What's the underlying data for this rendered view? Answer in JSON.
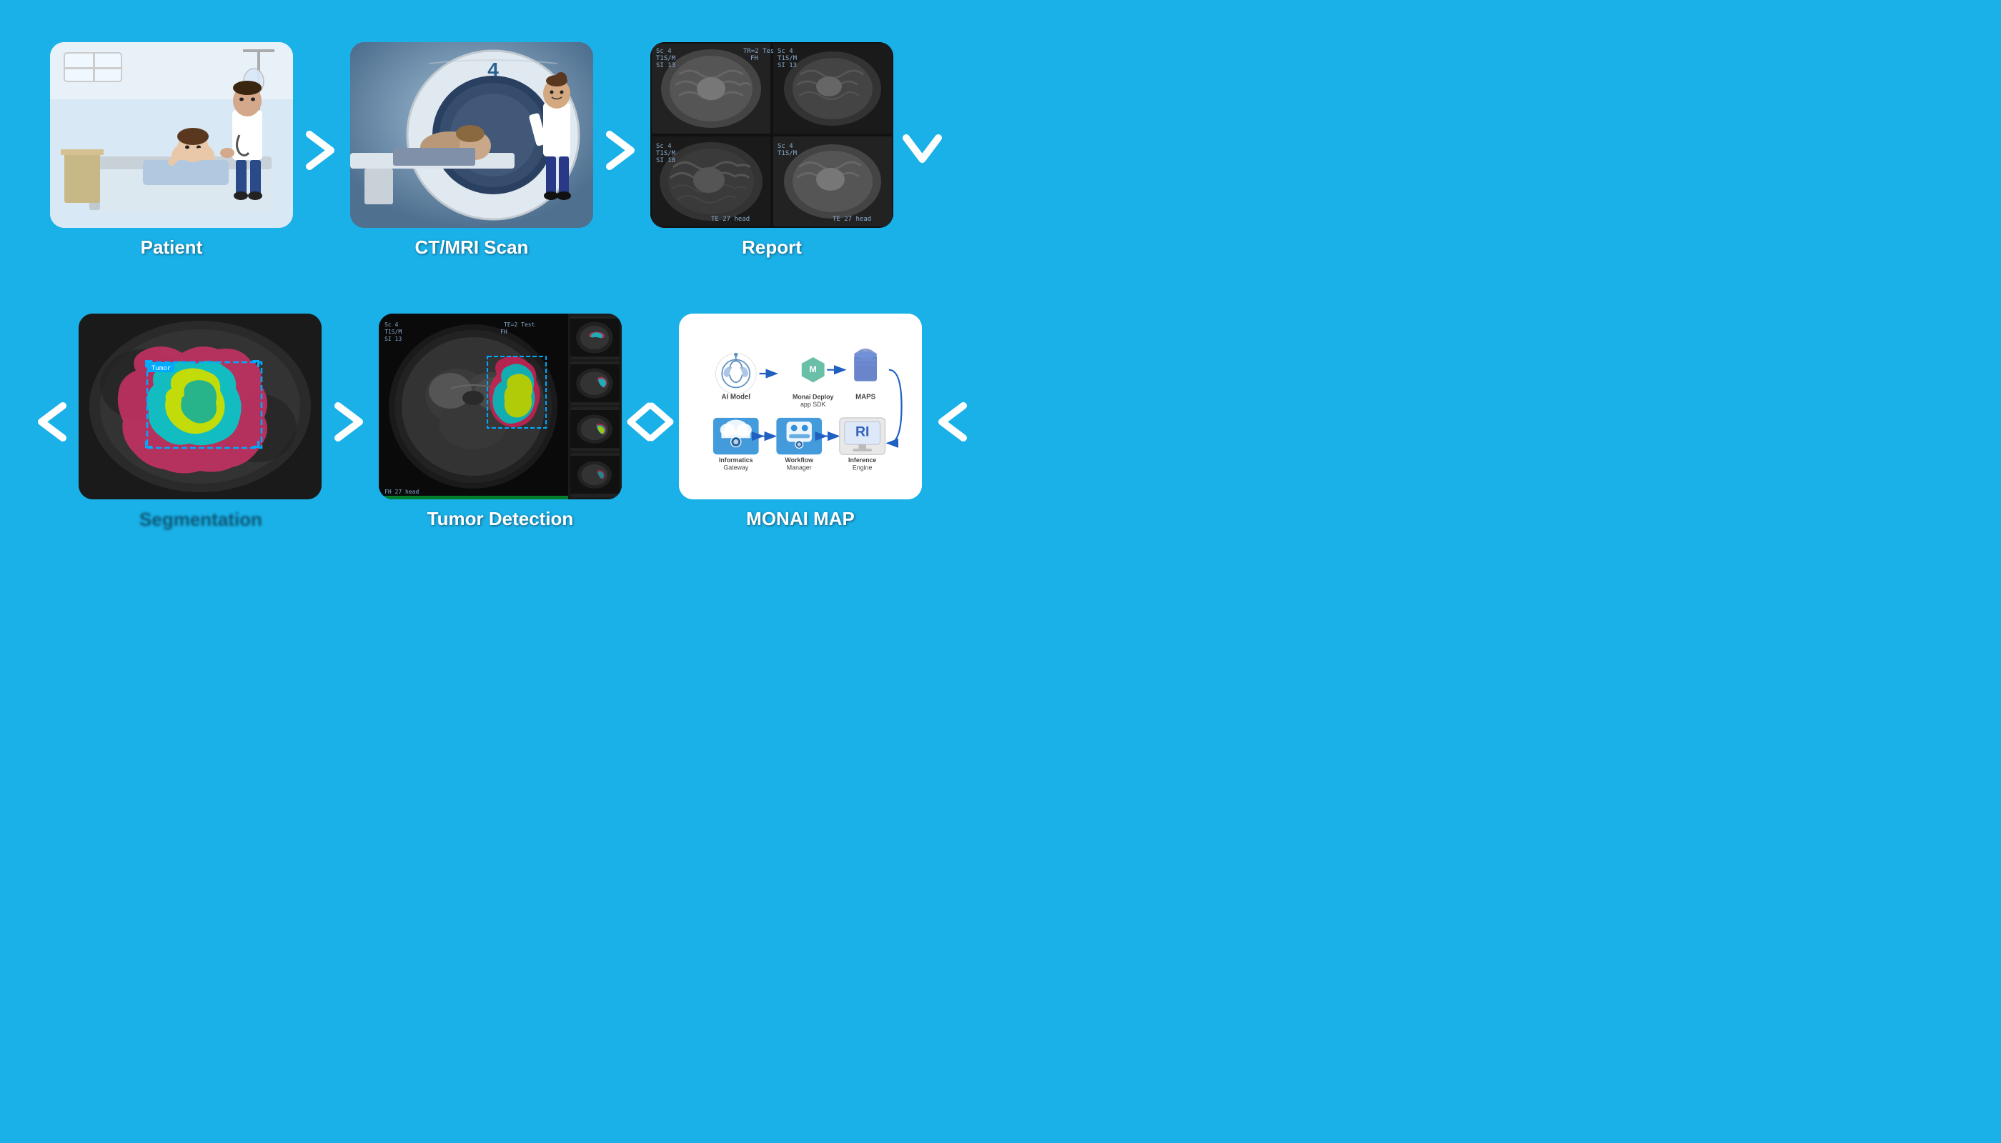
{
  "background_color": "#1ab0e8",
  "rows": {
    "row1": {
      "items": [
        {
          "id": "patient",
          "label": "Patient"
        },
        {
          "id": "ct_mri",
          "label": "CT/MRI Scan"
        },
        {
          "id": "report",
          "label": "Report"
        }
      ]
    },
    "row2": {
      "items": [
        {
          "id": "segmentation",
          "label": ""
        },
        {
          "id": "tumor_detection",
          "label": "Tumor Detection"
        },
        {
          "id": "monai_map",
          "label": "MONAI MAP"
        }
      ]
    }
  },
  "monai": {
    "items": [
      {
        "id": "ai_model",
        "label": "AI Model",
        "icon": "brain"
      },
      {
        "id": "monai_deploy",
        "label": "Monai Deploy\napp SDK",
        "icon": "hexagon"
      },
      {
        "id": "maps",
        "label": "MAPS",
        "icon": "bucket"
      },
      {
        "id": "informatics",
        "label": "Informatics\nGateway",
        "icon": "cloud-gear"
      },
      {
        "id": "workflow_manager",
        "label": "Workflow\nManager",
        "icon": "robot"
      },
      {
        "id": "inference_engine",
        "label": "Inference\nEngine",
        "icon": "monitor-ai"
      }
    ]
  },
  "arrows": {
    "right": "❯",
    "left": "❮",
    "down": "❯"
  }
}
